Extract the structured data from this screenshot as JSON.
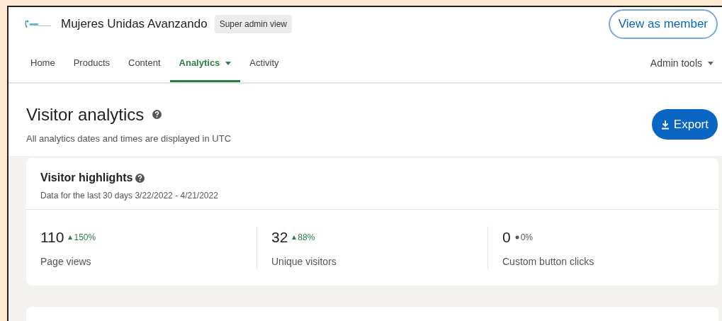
{
  "header": {
    "org_name": "Mujeres Unidas Avanzando",
    "badge": "Super admin view",
    "view_button": "View as member"
  },
  "nav": {
    "tabs": [
      {
        "label": "Home",
        "selected": false,
        "dropdown": false
      },
      {
        "label": "Products",
        "selected": false,
        "dropdown": false
      },
      {
        "label": "Content",
        "selected": false,
        "dropdown": false
      },
      {
        "label": "Analytics",
        "selected": true,
        "dropdown": true
      },
      {
        "label": "Activity",
        "selected": false,
        "dropdown": false
      }
    ],
    "admin_tools": "Admin tools"
  },
  "page": {
    "title": "Visitor analytics",
    "subtitle": "All analytics dates and times are displayed in UTC",
    "export_button": "Export"
  },
  "highlights": {
    "title": "Visitor highlights",
    "subtitle": "Data for the last 30 days 3/22/2022 - 4/21/2022",
    "metrics": [
      {
        "value": "110",
        "change": "150%",
        "kind": "up",
        "label": "Page views"
      },
      {
        "value": "32",
        "change": "88%",
        "kind": "up",
        "label": "Unique visitors"
      },
      {
        "value": "0",
        "change": "0%",
        "kind": "flat",
        "label": "Custom button clicks"
      }
    ]
  }
}
